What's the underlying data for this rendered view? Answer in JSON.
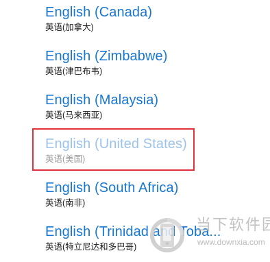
{
  "languages": [
    {
      "name": "English (Canada)",
      "native": "英语(加拿大)",
      "state": "normal"
    },
    {
      "name": "English (Zimbabwe)",
      "native": "英语(津巴布韦)",
      "state": "normal"
    },
    {
      "name": "English (Malaysia)",
      "native": "英语(马来西亚)",
      "state": "normal"
    },
    {
      "name": "English (United States)",
      "native": "英语(美国)",
      "state": "disabled"
    },
    {
      "name": "English (South Africa)",
      "native": "英语(南非)",
      "state": "normal"
    },
    {
      "name": "English (Trinidad and Toba...",
      "native": "英语(特立尼达和多巴哥)",
      "state": "normal"
    }
  ],
  "highlight": {
    "color": "#e0323a",
    "target": "English (United States)"
  },
  "colors": {
    "link": "#1776d0",
    "link_disabled": "#9cc3ea",
    "sub": "#1a1a1a",
    "sub_disabled": "#9a9a9a"
  },
  "watermark": {
    "title": "当下软件园",
    "url": "www.downxia.com",
    "icon": "downxia-logo-icon"
  }
}
